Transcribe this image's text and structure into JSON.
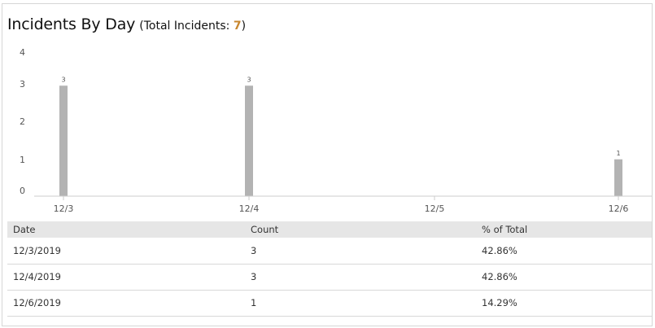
{
  "title": {
    "main": "Incidents By Day",
    "sub_prefix": "(Total Incidents: ",
    "total": "7",
    "sub_suffix": ")"
  },
  "chart_data": {
    "type": "bar",
    "categories": [
      "12/3",
      "12/4",
      "12/5",
      "12/6"
    ],
    "values": [
      3,
      3,
      0,
      1
    ],
    "data_labels": [
      "3",
      "3",
      "",
      "1"
    ],
    "y_ticks": [
      0,
      1,
      2,
      3,
      4
    ],
    "ylim": [
      0,
      4
    ],
    "grid": false,
    "bar_color": "#b3b3b3",
    "axis_color": "#cccccc"
  },
  "table": {
    "headers": [
      "Date",
      "Count",
      "% of Total"
    ],
    "rows": [
      [
        "12/3/2019",
        "3",
        "42.86%"
      ],
      [
        "12/4/2019",
        "3",
        "42.86%"
      ],
      [
        "12/6/2019",
        "1",
        "14.29%"
      ]
    ]
  }
}
